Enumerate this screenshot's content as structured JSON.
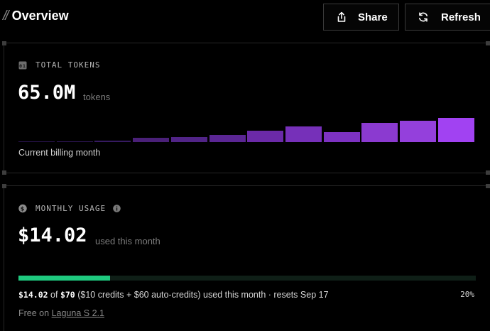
{
  "header": {
    "title_prefix": "//",
    "title": "Overview",
    "share_label": "Share",
    "share_icon": "share-icon",
    "refresh_label": "Refresh",
    "refresh_icon": "refresh-icon"
  },
  "tokens_card": {
    "label": "TOTAL TOKENS",
    "icon": "token-counter-icon",
    "value": "65.0M",
    "unit": "tokens",
    "caption": "Current billing month",
    "bar_levels": [
      0.03,
      0.04,
      0.06,
      0.17,
      0.19,
      0.27,
      0.44,
      0.61,
      0.39,
      0.75,
      0.83,
      0.94
    ],
    "bar_colors": [
      "#2a1450",
      "#301758",
      "#361a61",
      "#4a2078",
      "#512487",
      "#5b2694",
      "#6b2aa8",
      "#7630b9",
      "#7d32c2",
      "#8b3ad0",
      "#9440dc",
      "#a142f2"
    ]
  },
  "usage_card": {
    "label": "MONTHLY USAGE",
    "icon": "dollar-coin-icon",
    "info_icon": "info-icon",
    "value": "$14.02",
    "unit": "used this month",
    "progress_fraction": 0.2,
    "progress_color": "#1fc97f",
    "used": "$14.02",
    "of": "of",
    "limit": "$70",
    "detail": "($10 credits + $60 auto-credits) used this month · resets Sep 17",
    "percent": "20%",
    "free_prefix": "Free on",
    "free_link": "Laguna S 2.1"
  }
}
